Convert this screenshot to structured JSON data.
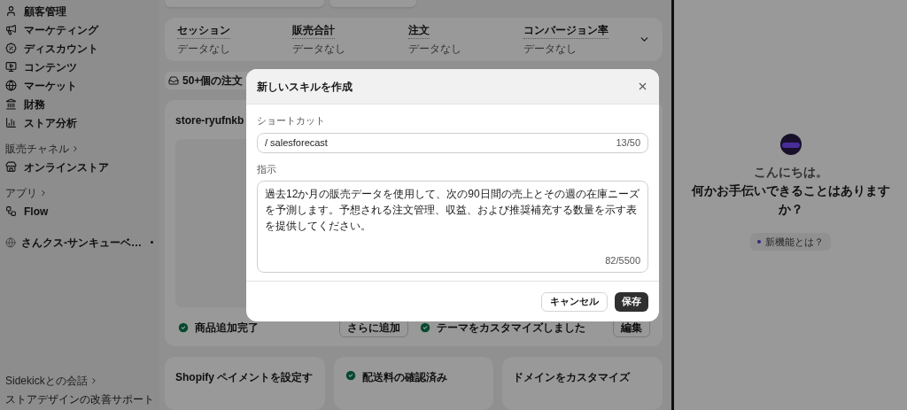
{
  "sidebar": {
    "items": [
      "顧客管理",
      "マーケティング",
      "ディスカウント",
      "コンテンツ",
      "マーケット",
      "財務",
      "ストア分析"
    ],
    "sections": [
      {
        "heading": "販売チャネル",
        "items": [
          "オンラインストア"
        ]
      },
      {
        "heading": "アプリ",
        "items": [
          "Flow"
        ]
      }
    ],
    "pinned": "さんクス-サンキューベ…",
    "sidekick_link": "Sidekickとの会話",
    "recent": "ストアデザインの改善サポート"
  },
  "metrics": [
    {
      "label": "セッション",
      "value": "データなし"
    },
    {
      "label": "販売合計",
      "value": "データなし"
    },
    {
      "label": "注文",
      "value": "データなし"
    },
    {
      "label": "コンバージョン率",
      "value": "データなし"
    }
  ],
  "orders_banner": "50+個の注文",
  "store": {
    "name": "store-ryufnkb",
    "tasks": [
      {
        "label": "商品追加完了",
        "done": true,
        "action": "さらに追加"
      },
      {
        "label": "テーマをカスタマイズしました",
        "done": true,
        "action": "編集"
      }
    ],
    "setup": [
      {
        "label": "Shopify ペイメントを設定す",
        "done": false
      },
      {
        "label": "配送料の確認済み",
        "done": true
      },
      {
        "label": "ドメインをカスタマイズ",
        "done": false
      }
    ]
  },
  "modal": {
    "title": "新しいスキルを作成",
    "shortcut": {
      "label": "ショートカット",
      "value": "/ salesforecast",
      "count": "13/50"
    },
    "instructions": {
      "label": "指示",
      "value": "過去12か月の販売データを使用して、次の90日間の売上とその週の在庫ニーズを予測します。予想される注文管理、収益、および推奨補充する数量を示す表を提供してください。",
      "count": "82/5500"
    },
    "buttons": [
      {
        "label": "キャンセル",
        "kind": "secondary"
      },
      {
        "label": "保存",
        "kind": "primary"
      }
    ]
  },
  "sidekick": {
    "greeting": "こんにちは。",
    "question": "何かお手伝いできることはありますか？",
    "whats_new": "新機能とは？"
  }
}
